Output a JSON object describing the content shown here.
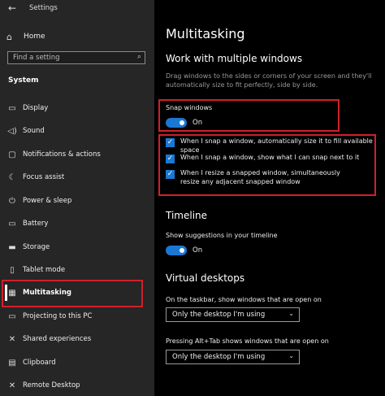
{
  "window": {
    "app_title": "Settings",
    "back_icon": "←"
  },
  "sidebar": {
    "home": {
      "icon": "⌂",
      "label": "Home"
    },
    "search": {
      "placeholder": "Find a setting",
      "icon": "⌕"
    },
    "section": "System",
    "items": [
      {
        "icon": "▭",
        "label": "Display"
      },
      {
        "icon": "◁)",
        "label": "Sound"
      },
      {
        "icon": "▢",
        "label": "Notifications & actions"
      },
      {
        "icon": "☾",
        "label": "Focus assist"
      },
      {
        "icon": "⏻",
        "label": "Power & sleep"
      },
      {
        "icon": "▭",
        "label": "Battery"
      },
      {
        "icon": "▬",
        "label": "Storage"
      },
      {
        "icon": "▯",
        "label": "Tablet mode"
      },
      {
        "icon": "▦",
        "label": "Multitasking"
      },
      {
        "icon": "▭",
        "label": "Projecting to this PC"
      },
      {
        "icon": "✕",
        "label": "Shared experiences"
      },
      {
        "icon": "▤",
        "label": "Clipboard"
      },
      {
        "icon": "✕",
        "label": "Remote Desktop"
      }
    ],
    "selected_index": 8
  },
  "main": {
    "title": "Multitasking",
    "work_heading": "Work with multiple windows",
    "work_description": "Drag windows to the sides or corners of your screen and they'll automatically size to fit perfectly, side by side.",
    "snap": {
      "label": "Snap windows",
      "state": "On"
    },
    "snap_options": [
      "When I snap a window, automatically size it to fill available space",
      "When I snap a window, show what I can snap next to it",
      "When I resize a snapped window, simultaneously resize any adjacent snapped window"
    ],
    "check_mark": "✓",
    "timeline": {
      "heading": "Timeline",
      "label": "Show suggestions in your timeline",
      "state": "On"
    },
    "virtual": {
      "heading": "Virtual desktops",
      "taskbar_label": "On the taskbar, show windows that are open on",
      "taskbar_value": "Only the desktop I'm using",
      "alttab_label": "Pressing Alt+Tab shows windows that are open on",
      "alttab_value": "Only the desktop I'm using",
      "chevron": "⌄"
    }
  },
  "colors": {
    "accent": "#1a78d4",
    "highlight_box": "#d0202a",
    "sidebar_bg": "#262626"
  }
}
